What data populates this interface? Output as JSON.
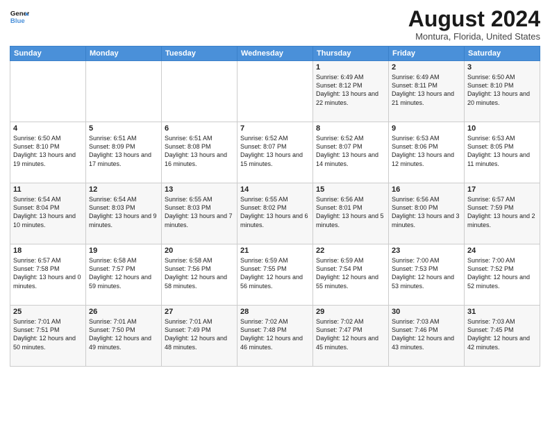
{
  "logo": {
    "line1": "General",
    "line2": "Blue"
  },
  "title": "August 2024",
  "location": "Montura, Florida, United States",
  "weekdays": [
    "Sunday",
    "Monday",
    "Tuesday",
    "Wednesday",
    "Thursday",
    "Friday",
    "Saturday"
  ],
  "weeks": [
    [
      {
        "day": "",
        "sunrise": "",
        "sunset": "",
        "daylight": ""
      },
      {
        "day": "",
        "sunrise": "",
        "sunset": "",
        "daylight": ""
      },
      {
        "day": "",
        "sunrise": "",
        "sunset": "",
        "daylight": ""
      },
      {
        "day": "",
        "sunrise": "",
        "sunset": "",
        "daylight": ""
      },
      {
        "day": "1",
        "sunrise": "Sunrise: 6:49 AM",
        "sunset": "Sunset: 8:12 PM",
        "daylight": "Daylight: 13 hours and 22 minutes."
      },
      {
        "day": "2",
        "sunrise": "Sunrise: 6:49 AM",
        "sunset": "Sunset: 8:11 PM",
        "daylight": "Daylight: 13 hours and 21 minutes."
      },
      {
        "day": "3",
        "sunrise": "Sunrise: 6:50 AM",
        "sunset": "Sunset: 8:10 PM",
        "daylight": "Daylight: 13 hours and 20 minutes."
      }
    ],
    [
      {
        "day": "4",
        "sunrise": "Sunrise: 6:50 AM",
        "sunset": "Sunset: 8:10 PM",
        "daylight": "Daylight: 13 hours and 19 minutes."
      },
      {
        "day": "5",
        "sunrise": "Sunrise: 6:51 AM",
        "sunset": "Sunset: 8:09 PM",
        "daylight": "Daylight: 13 hours and 17 minutes."
      },
      {
        "day": "6",
        "sunrise": "Sunrise: 6:51 AM",
        "sunset": "Sunset: 8:08 PM",
        "daylight": "Daylight: 13 hours and 16 minutes."
      },
      {
        "day": "7",
        "sunrise": "Sunrise: 6:52 AM",
        "sunset": "Sunset: 8:07 PM",
        "daylight": "Daylight: 13 hours and 15 minutes."
      },
      {
        "day": "8",
        "sunrise": "Sunrise: 6:52 AM",
        "sunset": "Sunset: 8:07 PM",
        "daylight": "Daylight: 13 hours and 14 minutes."
      },
      {
        "day": "9",
        "sunrise": "Sunrise: 6:53 AM",
        "sunset": "Sunset: 8:06 PM",
        "daylight": "Daylight: 13 hours and 12 minutes."
      },
      {
        "day": "10",
        "sunrise": "Sunrise: 6:53 AM",
        "sunset": "Sunset: 8:05 PM",
        "daylight": "Daylight: 13 hours and 11 minutes."
      }
    ],
    [
      {
        "day": "11",
        "sunrise": "Sunrise: 6:54 AM",
        "sunset": "Sunset: 8:04 PM",
        "daylight": "Daylight: 13 hours and 10 minutes."
      },
      {
        "day": "12",
        "sunrise": "Sunrise: 6:54 AM",
        "sunset": "Sunset: 8:03 PM",
        "daylight": "Daylight: 13 hours and 9 minutes."
      },
      {
        "day": "13",
        "sunrise": "Sunrise: 6:55 AM",
        "sunset": "Sunset: 8:03 PM",
        "daylight": "Daylight: 13 hours and 7 minutes."
      },
      {
        "day": "14",
        "sunrise": "Sunrise: 6:55 AM",
        "sunset": "Sunset: 8:02 PM",
        "daylight": "Daylight: 13 hours and 6 minutes."
      },
      {
        "day": "15",
        "sunrise": "Sunrise: 6:56 AM",
        "sunset": "Sunset: 8:01 PM",
        "daylight": "Daylight: 13 hours and 5 minutes."
      },
      {
        "day": "16",
        "sunrise": "Sunrise: 6:56 AM",
        "sunset": "Sunset: 8:00 PM",
        "daylight": "Daylight: 13 hours and 3 minutes."
      },
      {
        "day": "17",
        "sunrise": "Sunrise: 6:57 AM",
        "sunset": "Sunset: 7:59 PM",
        "daylight": "Daylight: 13 hours and 2 minutes."
      }
    ],
    [
      {
        "day": "18",
        "sunrise": "Sunrise: 6:57 AM",
        "sunset": "Sunset: 7:58 PM",
        "daylight": "Daylight: 13 hours and 0 minutes."
      },
      {
        "day": "19",
        "sunrise": "Sunrise: 6:58 AM",
        "sunset": "Sunset: 7:57 PM",
        "daylight": "Daylight: 12 hours and 59 minutes."
      },
      {
        "day": "20",
        "sunrise": "Sunrise: 6:58 AM",
        "sunset": "Sunset: 7:56 PM",
        "daylight": "Daylight: 12 hours and 58 minutes."
      },
      {
        "day": "21",
        "sunrise": "Sunrise: 6:59 AM",
        "sunset": "Sunset: 7:55 PM",
        "daylight": "Daylight: 12 hours and 56 minutes."
      },
      {
        "day": "22",
        "sunrise": "Sunrise: 6:59 AM",
        "sunset": "Sunset: 7:54 PM",
        "daylight": "Daylight: 12 hours and 55 minutes."
      },
      {
        "day": "23",
        "sunrise": "Sunrise: 7:00 AM",
        "sunset": "Sunset: 7:53 PM",
        "daylight": "Daylight: 12 hours and 53 minutes."
      },
      {
        "day": "24",
        "sunrise": "Sunrise: 7:00 AM",
        "sunset": "Sunset: 7:52 PM",
        "daylight": "Daylight: 12 hours and 52 minutes."
      }
    ],
    [
      {
        "day": "25",
        "sunrise": "Sunrise: 7:01 AM",
        "sunset": "Sunset: 7:51 PM",
        "daylight": "Daylight: 12 hours and 50 minutes."
      },
      {
        "day": "26",
        "sunrise": "Sunrise: 7:01 AM",
        "sunset": "Sunset: 7:50 PM",
        "daylight": "Daylight: 12 hours and 49 minutes."
      },
      {
        "day": "27",
        "sunrise": "Sunrise: 7:01 AM",
        "sunset": "Sunset: 7:49 PM",
        "daylight": "Daylight: 12 hours and 48 minutes."
      },
      {
        "day": "28",
        "sunrise": "Sunrise: 7:02 AM",
        "sunset": "Sunset: 7:48 PM",
        "daylight": "Daylight: 12 hours and 46 minutes."
      },
      {
        "day": "29",
        "sunrise": "Sunrise: 7:02 AM",
        "sunset": "Sunset: 7:47 PM",
        "daylight": "Daylight: 12 hours and 45 minutes."
      },
      {
        "day": "30",
        "sunrise": "Sunrise: 7:03 AM",
        "sunset": "Sunset: 7:46 PM",
        "daylight": "Daylight: 12 hours and 43 minutes."
      },
      {
        "day": "31",
        "sunrise": "Sunrise: 7:03 AM",
        "sunset": "Sunset: 7:45 PM",
        "daylight": "Daylight: 12 hours and 42 minutes."
      }
    ]
  ]
}
